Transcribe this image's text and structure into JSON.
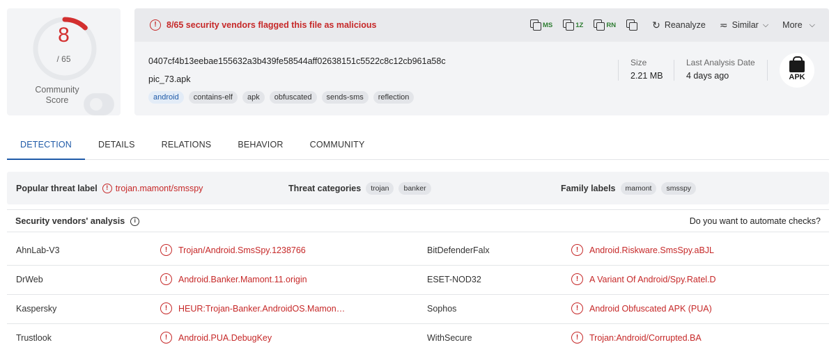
{
  "score": {
    "detections": "8",
    "total": "/ 65",
    "fraction": 0.123,
    "community_label": "Community\nScore"
  },
  "alert": {
    "icon": "!",
    "text": "8/65 security vendors flagged this file as malicious"
  },
  "toolbar": {
    "copy_buttons": [
      {
        "label": "MS"
      },
      {
        "label": "1Z"
      },
      {
        "label": "RN"
      },
      {
        "label": ""
      }
    ],
    "reanalyze": "Reanalyze",
    "similar": "Similar",
    "more": "More"
  },
  "file": {
    "hash": "0407cf4b13eebae155632a3b439fe58544aff02638151c5522c8c12cb961a58c",
    "name": "pic_73.apk",
    "tags": [
      "android",
      "contains-elf",
      "apk",
      "obfuscated",
      "sends-sms",
      "reflection"
    ],
    "size_label": "Size",
    "size_value": "2.21 MB",
    "date_label": "Last Analysis Date",
    "date_value": "4 days ago",
    "type_badge": "APK"
  },
  "tabs": [
    "DETECTION",
    "DETAILS",
    "RELATIONS",
    "BEHAVIOR",
    "COMMUNITY"
  ],
  "summary": {
    "threat_label_title": "Popular threat label",
    "threat_label_value": "trojan.mamont/smsspy",
    "categories_title": "Threat categories",
    "categories": [
      "trojan",
      "banker"
    ],
    "family_title": "Family labels",
    "family": [
      "mamont",
      "smsspy"
    ]
  },
  "vendors": {
    "title": "Security vendors' analysis",
    "automate": "Do you want to automate checks?",
    "rows": [
      {
        "v1": "AhnLab-V3",
        "r1": "Trojan/Android.SmsSpy.1238766",
        "v2": "BitDefenderFalx",
        "r2": "Android.Riskware.SmsSpy.aBJL"
      },
      {
        "v1": "DrWeb",
        "r1": "Android.Banker.Mamont.11.origin",
        "v2": "ESET-NOD32",
        "r2": "A Variant Of Android/Spy.Ratel.D"
      },
      {
        "v1": "Kaspersky",
        "r1": "HEUR:Trojan-Banker.AndroidOS.Mamon…",
        "v2": "Sophos",
        "r2": "Android Obfuscated APK (PUA)"
      },
      {
        "v1": "Trustlook",
        "r1": "Android.PUA.DebugKey",
        "v2": "WithSecure",
        "r2": "Trojan:Android/Corrupted.BA"
      }
    ]
  },
  "colors": {
    "danger": "#c62828",
    "accent": "#1f5aa8",
    "panel": "#f3f4f6"
  },
  "icons": {
    "alert": "exclamation-circle-icon",
    "copy": "copy-icon",
    "reanalyze": "refresh-icon",
    "similar": "similar-icon",
    "chevron": "chevron-down-icon",
    "info": "info-circle-icon",
    "apk": "android-apk-icon"
  }
}
